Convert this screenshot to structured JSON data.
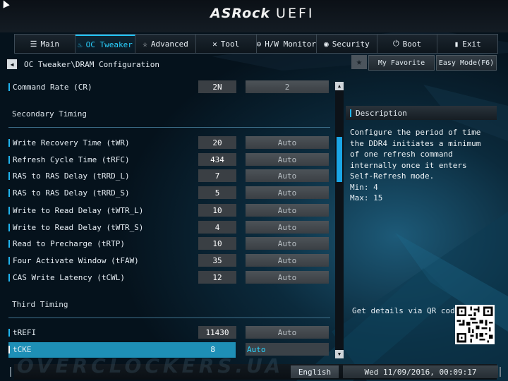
{
  "header": {
    "brand": "ASRock",
    "product": "UEFI"
  },
  "tabs": [
    {
      "label": "Main",
      "icon": "list-icon",
      "active": false
    },
    {
      "label": "OC Tweaker",
      "icon": "flame-icon",
      "active": true
    },
    {
      "label": "Advanced",
      "icon": "star-icon",
      "active": false
    },
    {
      "label": "Tool",
      "icon": "tools-icon",
      "active": false
    },
    {
      "label": "H/W Monitor",
      "icon": "monitor-icon",
      "active": false
    },
    {
      "label": "Security",
      "icon": "shield-icon",
      "active": false
    },
    {
      "label": "Boot",
      "icon": "power-icon",
      "active": false
    },
    {
      "label": "Exit",
      "icon": "exit-icon",
      "active": false
    }
  ],
  "breadcrumb": "OC Tweaker\\DRAM Configuration",
  "buttons": {
    "my_favorite": "My Favorite",
    "easy_mode": "Easy Mode(F6)"
  },
  "settings": {
    "command_rate": {
      "label": "Command Rate (CR)",
      "value": "2N",
      "option": "2"
    },
    "secondary_title": "Secondary Timing",
    "secondary": [
      {
        "label": "Write Recovery Time (tWR)",
        "value": "20",
        "option": "Auto"
      },
      {
        "label": "Refresh Cycle Time (tRFC)",
        "value": "434",
        "option": "Auto"
      },
      {
        "label": "RAS to RAS Delay (tRRD_L)",
        "value": "7",
        "option": "Auto"
      },
      {
        "label": "RAS to RAS Delay (tRRD_S)",
        "value": "5",
        "option": "Auto"
      },
      {
        "label": "Write to Read Delay (tWTR_L)",
        "value": "10",
        "option": "Auto"
      },
      {
        "label": "Write to Read Delay (tWTR_S)",
        "value": "4",
        "option": "Auto"
      },
      {
        "label": "Read to Precharge (tRTP)",
        "value": "10",
        "option": "Auto"
      },
      {
        "label": "Four Activate Window (tFAW)",
        "value": "35",
        "option": "Auto"
      },
      {
        "label": "CAS Write Latency (tCWL)",
        "value": "12",
        "option": "Auto"
      }
    ],
    "third_title": "Third Timing",
    "third": [
      {
        "label": "tREFI",
        "value": "11430",
        "option": "Auto"
      },
      {
        "label": "tCKE",
        "value": "8",
        "option": "Auto",
        "selected": true
      }
    ]
  },
  "description": {
    "title": "Description",
    "text": "Configure the period of time the DDR4 initiates a minimum of one refresh command internally once it enters Self-Refresh mode.",
    "min": "Min: 4",
    "max": "Max: 15",
    "qr_text": "Get details via QR code"
  },
  "footer": {
    "watermark": "OVERCLOCKERS.UA",
    "language": "English",
    "datetime": "Wed 11/09/2016, 00:09:17"
  },
  "colors": {
    "accent": "#1fc2ff",
    "selected_row": "#1e8fb6",
    "background": "#05121c"
  }
}
